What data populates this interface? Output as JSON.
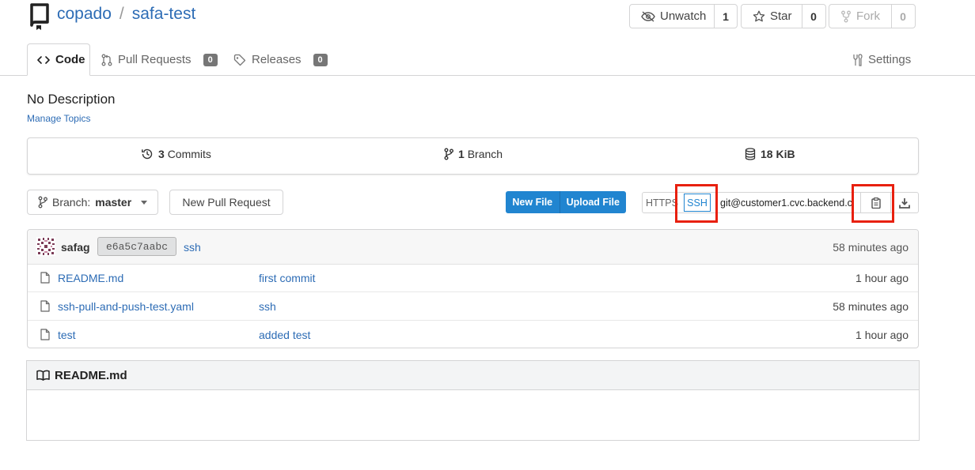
{
  "repo": {
    "owner": "copado",
    "separator": "/",
    "name": "safa-test"
  },
  "actions": {
    "watch": {
      "label": "Unwatch",
      "count": "1"
    },
    "star": {
      "label": "Star",
      "count": "0"
    },
    "fork": {
      "label": "Fork",
      "count": "0"
    }
  },
  "tabs": {
    "code": "Code",
    "pulls": {
      "label": "Pull Requests",
      "count": "0"
    },
    "releases": {
      "label": "Releases",
      "count": "0"
    },
    "settings": "Settings"
  },
  "description": "No Description",
  "manage_topics": "Manage Topics",
  "stats": {
    "commits": {
      "count": "3",
      "label": "Commits"
    },
    "branches": {
      "count": "1",
      "label": "Branch"
    },
    "size": "18 KiB"
  },
  "toolbar": {
    "branch_prefix": "Branch:",
    "branch_name": "master",
    "new_pr": "New Pull Request",
    "new_file": "New File",
    "upload_file": "Upload File"
  },
  "clone": {
    "https": "HTTPS",
    "ssh": "SSH",
    "url": "git@customer1.cvc.backend.c"
  },
  "last_commit": {
    "author": "safag",
    "sha": "e6a5c7aabc",
    "message": "ssh",
    "time": "58 minutes ago"
  },
  "files": [
    {
      "name": "README.md",
      "message": "first commit",
      "time": "1 hour ago"
    },
    {
      "name": "ssh-pull-and-push-test.yaml",
      "message": "ssh",
      "time": "58 minutes ago"
    },
    {
      "name": "test",
      "message": "added test",
      "time": "1 hour ago"
    }
  ],
  "readme": {
    "title": "README.md"
  },
  "colors": {
    "link": "#2d6cb5",
    "primary": "#2185d0",
    "highlight": "#e8200f"
  }
}
